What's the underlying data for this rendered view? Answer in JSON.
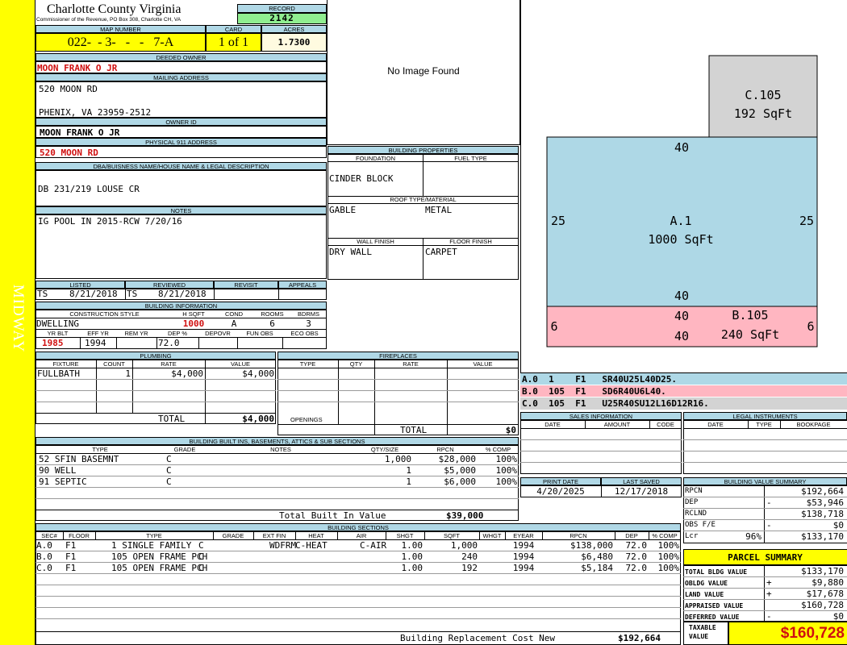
{
  "side_label": "MIDWAY",
  "header": {
    "county": "Charlotte County Virginia",
    "commissioner": "Commissioner of the Revenue, PO Box 308, Charlotte CH, VA",
    "record_label": "RECORD",
    "record": "2142",
    "map_number_label": "MAP NUMBER",
    "map_number": "022-  - 3-   -   -   7-A",
    "card_label": "CARD",
    "card": "1 of 1",
    "acres_label": "ACRES",
    "acres": "1.7300"
  },
  "owner": {
    "deeded_label": "DEEDED OWNER",
    "deeded": "MOON FRANK O JR",
    "mailing_label": "MAILING ADDRESS",
    "mailing_1": "520 MOON RD",
    "mailing_2": "PHENIX, VA 23959-2512",
    "owner_id_label": "OWNER ID",
    "owner_id": "MOON FRANK O JR",
    "physical_label": "PHYSICAL 911 ADDRESS",
    "physical": "520 MOON RD",
    "dba_label": "DBA/BUISNESS NAME/HOUSE NAME & LEGAL DESCRIPTION",
    "dba": "DB 231/219 LOUSE CR",
    "notes_label": "NOTES",
    "notes": "IG POOL IN 2015-RCW 7/20/16"
  },
  "image_text": "No Image Found",
  "building_props": {
    "title": "BUILDING PROPERTIES",
    "foundation_label": "FOUNDATION",
    "fuel_label": "FUEL TYPE",
    "foundation": "CINDER BLOCK",
    "fuel": "",
    "roof_label": "ROOF TYPE/MATERIAL",
    "roof_type": "GABLE",
    "roof_material": "METAL",
    "wall_label": "WALL FINISH",
    "floor_label": "FLOOR FINISH",
    "wall": "DRY WALL",
    "floor": "CARPET"
  },
  "review": {
    "listed_label": "LISTED",
    "reviewed_label": "REVIEWED",
    "revisit_label": "REVISIT",
    "appeals_label": "APPEALS",
    "listed_by": "TS",
    "listed_date": "8/21/2018",
    "reviewed_by": "TS",
    "reviewed_date": "8/21/2018"
  },
  "building_info": {
    "title": "BUILDING INFORMATION",
    "style_label": "CONSTRUCTION STYLE",
    "hsqft_label": "H SQFT",
    "cond_label": "COND",
    "rooms_label": "ROOMS",
    "bdrms_label": "BDRMS",
    "style": "DWELLING",
    "hsqft": "1000",
    "cond": "A",
    "rooms": "6",
    "bdrms": "3",
    "yrblt_label": "YR BLT",
    "effyr_label": "EFF YR",
    "remyr_label": "REM YR",
    "dep_label": "DEP %",
    "depovr_label": "DEPOVR",
    "funobs_label": "FUN OBS",
    "ecoobs_label": "ECO OBS",
    "yrblt": "1985",
    "effyr": "1994",
    "dep": "72.0"
  },
  "plumbing": {
    "title": "PLUMBING",
    "cols": [
      "FIXTURE",
      "COUNT",
      "RATE",
      "VALUE"
    ],
    "rows": [
      [
        "FULLBATH",
        "1",
        "$4,000",
        "$4,000"
      ]
    ],
    "total_label": "TOTAL",
    "total": "$4,000"
  },
  "fireplaces": {
    "title": "FIREPLACES",
    "cols": [
      "TYPE",
      "QTY",
      "RATE",
      "VALUE"
    ],
    "openings_label": "OPENINGS",
    "total_label": "TOTAL",
    "total": "$0"
  },
  "built_ins": {
    "title": "BUILDING BUILT INS, BASEMENTS, ATTICS & SUB SECTIONS",
    "cols": [
      "TYPE",
      "GRADE",
      "NOTES",
      "QTY/SIZE",
      "RPCN",
      "% COMP"
    ],
    "rows": [
      [
        "52 SFIN BASEMNT",
        "C",
        "",
        "1,000",
        "$28,000",
        "100%"
      ],
      [
        "90 WELL",
        "C",
        "",
        "1",
        "$5,000",
        "100%"
      ],
      [
        "91 SEPTIC",
        "C",
        "",
        "1",
        "$6,000",
        "100%"
      ]
    ],
    "total_label": "Total Built In Value",
    "total": "$39,000"
  },
  "sections": {
    "title": "BUILDING SECTIONS",
    "cols": [
      "SEC#",
      "FLOOR",
      "TYPE",
      "GRADE",
      "EXT FIN",
      "HEAT",
      "AIR",
      "SHGT",
      "SQFT",
      "WHGT",
      "EYEAR",
      "RPCN",
      "DEP",
      "% COMP"
    ],
    "rows": [
      [
        "A.0",
        "F1",
        "1 SINGLE FAMILY",
        "C",
        "WDFRM",
        "C-HEAT",
        "C-AIR",
        "1.00",
        "1,000",
        "",
        "1994",
        "$138,000",
        "72.0",
        "100%"
      ],
      [
        "B.0",
        "F1",
        "105 OPEN FRAME PCH",
        "C",
        "",
        "",
        "",
        "1.00",
        "240",
        "",
        "1994",
        "$6,480",
        "72.0",
        "100%"
      ],
      [
        "C.0",
        "F1",
        "105 OPEN FRAME PCH",
        "C",
        "",
        "",
        "",
        "1.00",
        "192",
        "",
        "1994",
        "$5,184",
        "72.0",
        "100%"
      ]
    ],
    "rcn_label": "Building Replacement Cost New",
    "rcn": "$192,664"
  },
  "sketch": {
    "c_label": "C.105",
    "c_area": "192 SqFt",
    "a_label": "A.1",
    "a_area": "1000 SqFt",
    "a_top": "40",
    "a_bottom": "40",
    "a_left": "25",
    "a_right": "25",
    "b_label": "B.105",
    "b_area": "240 SqFt",
    "b_top": "40",
    "b_bottom": "40",
    "b_left": "6",
    "b_right": "6",
    "colors": {
      "a": "#aed8e6",
      "b": "#ffb6c1",
      "c": "#d3d3d3"
    }
  },
  "vectors": [
    "A.0  1    F1   SR40U25L40D25.",
    "B.0  105  F1   SD6R40U6L40.",
    "C.0  105  F1   U25R40SU12L16D12R16."
  ],
  "sales": {
    "title": "SALES INFORMATION",
    "cols": [
      "DATE",
      "AMOUNT",
      "CODE"
    ]
  },
  "legal": {
    "title": "LEGAL INSTRUMENTS",
    "cols": [
      "DATE",
      "TYPE",
      "BOOKPAGE"
    ]
  },
  "dates": {
    "print_label": "PRINT DATE",
    "saved_label": "LAST SAVED",
    "print": "4/20/2025",
    "saved": "12/17/2018"
  },
  "value_summary": {
    "title": "BUILDING VALUE SUMMARY",
    "rpcn_label": "RPCN",
    "rpcn": "$192,664",
    "dep_label": "DEP",
    "dep_sign": "-",
    "dep": "$53,946",
    "rclnd_label": "RCLND",
    "rclnd": "$138,718",
    "obs_label": "OBS F/E",
    "obs_sign": "-",
    "obs": "$0",
    "lcr_label": "Lcr",
    "lcr_pct": "96%",
    "lcr": "$133,170"
  },
  "parcel": {
    "title": "PARCEL SUMMARY",
    "bldg_label": "TOTAL BLDG VALUE",
    "bldg": "$133,170",
    "obldg_label": "OBLDG VALUE",
    "obldg_sign": "+",
    "obldg": "$9,880",
    "land_label": "LAND VALUE",
    "land_sign": "+",
    "land": "$17,678",
    "appraised_label": "APPRAISED VALUE",
    "appraised": "$160,728",
    "deferred_label": "DEFERRED VALUE",
    "deferred_sign": "-",
    "deferred": "$0",
    "taxable_label_1": "TAXABLE",
    "taxable_label_2": "VALUE",
    "taxable": "$160,728"
  }
}
